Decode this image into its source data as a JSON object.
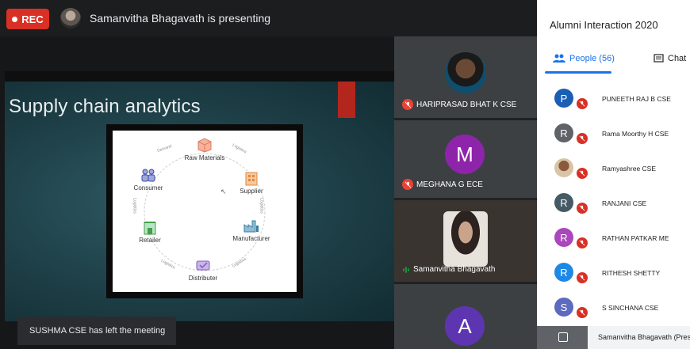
{
  "topbar": {
    "rec_label": "REC",
    "presenting_text": "Samanvitha Bhagavath is presenting"
  },
  "slide": {
    "title": "Supply chain analytics",
    "nodes": {
      "raw_materials": "Raw Materials",
      "supplier": "Supplier",
      "manufacturer": "Manufacturer",
      "distributer": "Distributer",
      "retailer": "Retailer",
      "consumer": "Consumer"
    },
    "arrow_labels": {
      "demand": "Demand",
      "logistics": "Logistics"
    }
  },
  "toast": {
    "text": "SUSHMA CSE has left the meeting"
  },
  "tiles": [
    {
      "name": "HARIPRASAD BHAT K CSE"
    },
    {
      "name": "MEGHANA G ECE",
      "initial": "M",
      "color": "#8e24aa"
    },
    {
      "name": "Samanvitha Bhagavath"
    },
    {
      "name": "",
      "initial": "A",
      "color": "#5e35b1"
    }
  ],
  "panel": {
    "title": "Alumni Interaction 2020",
    "people_tab": "People (56)",
    "chat_tab": "Chat",
    "people": [
      {
        "initial": "P",
        "name": "PUNEETH RAJ B CSE",
        "color": "#1a5fb4"
      },
      {
        "initial": "R",
        "name": "Rama Moorthy H CSE",
        "color": "#5f6368"
      },
      {
        "initial": "",
        "name": "Ramyashree CSE",
        "color": "#c9b08a"
      },
      {
        "initial": "R",
        "name": "RANJANI CSE",
        "color": "#455a64"
      },
      {
        "initial": "R",
        "name": "RATHAN PATKAR ME",
        "color": "#ab47bc"
      },
      {
        "initial": "R",
        "name": "RITHESH SHETTY",
        "color": "#1e88e5"
      },
      {
        "initial": "S",
        "name": "S SINCHANA CSE",
        "color": "#5c6bc0"
      }
    ],
    "footer_text": "Samanvitha Bhagavath (Pres"
  }
}
